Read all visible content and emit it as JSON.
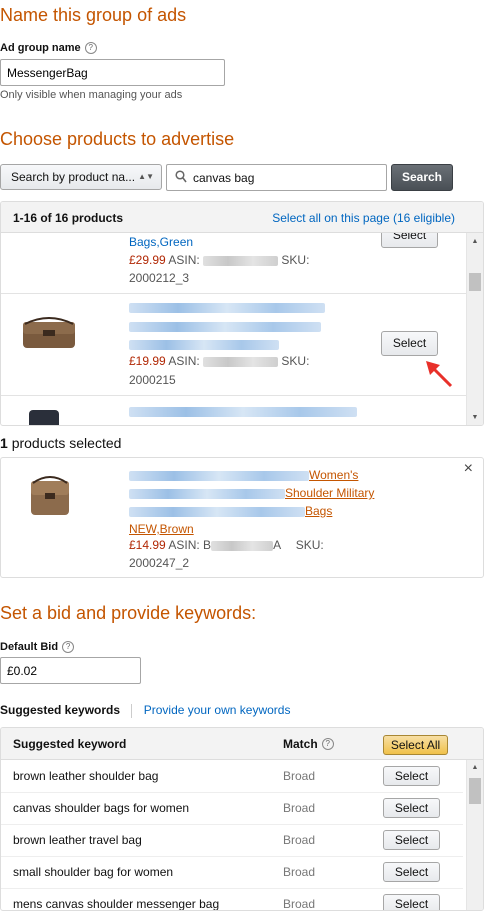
{
  "name_group": {
    "title": "Name this group of ads",
    "label": "Ad group name",
    "value": "MessengerBag",
    "hint": "Only visible when managing your ads"
  },
  "choose": {
    "title": "Choose products to advertise",
    "search_by": "Search by product na...",
    "search_value": "canvas bag",
    "search_button": "Search"
  },
  "results": {
    "count": "1-16 of 16 products",
    "select_all_link": "Select all on this page (16 eligible)",
    "items": [
      {
        "title_tail": "Bags,Green",
        "price": "£29.99",
        "asin_label": "ASIN:",
        "sku_label": "SKU:",
        "sku": "2000212_3",
        "select": "Select"
      },
      {
        "price": "£19.99",
        "asin_label": "ASIN:",
        "sku_label": "SKU:",
        "sku": "2000215",
        "select": "Select"
      }
    ]
  },
  "selected": {
    "count": "1",
    "label": "products selected",
    "item": {
      "title_l1": "Women's",
      "title_l2": "Shoulder Military",
      "title_l3": "Bags",
      "title_l4": "NEW,Brown",
      "price": "£14.99",
      "asin_label": "ASIN: B",
      "asin_tail": "A",
      "sku_label": "SKU:",
      "sku": "2000247_2",
      "remove": "×"
    }
  },
  "bid": {
    "title": "Set a bid and provide keywords:",
    "label": "Default Bid",
    "value": "£0.02"
  },
  "keywords": {
    "tab_suggested": "Suggested keywords",
    "tab_own": "Provide your own keywords",
    "col_keyword": "Suggested keyword",
    "col_match": "Match",
    "select_all": "Select All",
    "rows": [
      {
        "keyword": "brown leather shoulder bag",
        "match": "Broad",
        "select": "Select"
      },
      {
        "keyword": "canvas shoulder bags for women",
        "match": "Broad",
        "select": "Select"
      },
      {
        "keyword": "brown leather travel bag",
        "match": "Broad",
        "select": "Select"
      },
      {
        "keyword": "small shoulder bag for women",
        "match": "Broad",
        "select": "Select"
      },
      {
        "keyword": "mens canvas shoulder messenger bag",
        "match": "Broad",
        "select": "Select"
      }
    ]
  },
  "icons": {
    "help": "help-icon",
    "search": "magnifier-icon",
    "close": "close-icon",
    "annotation": "red-arrow-icon"
  },
  "colors": {
    "heading": "#c45500",
    "link": "#0066c0",
    "price": "#b12704",
    "annotation": "#e8302a"
  }
}
